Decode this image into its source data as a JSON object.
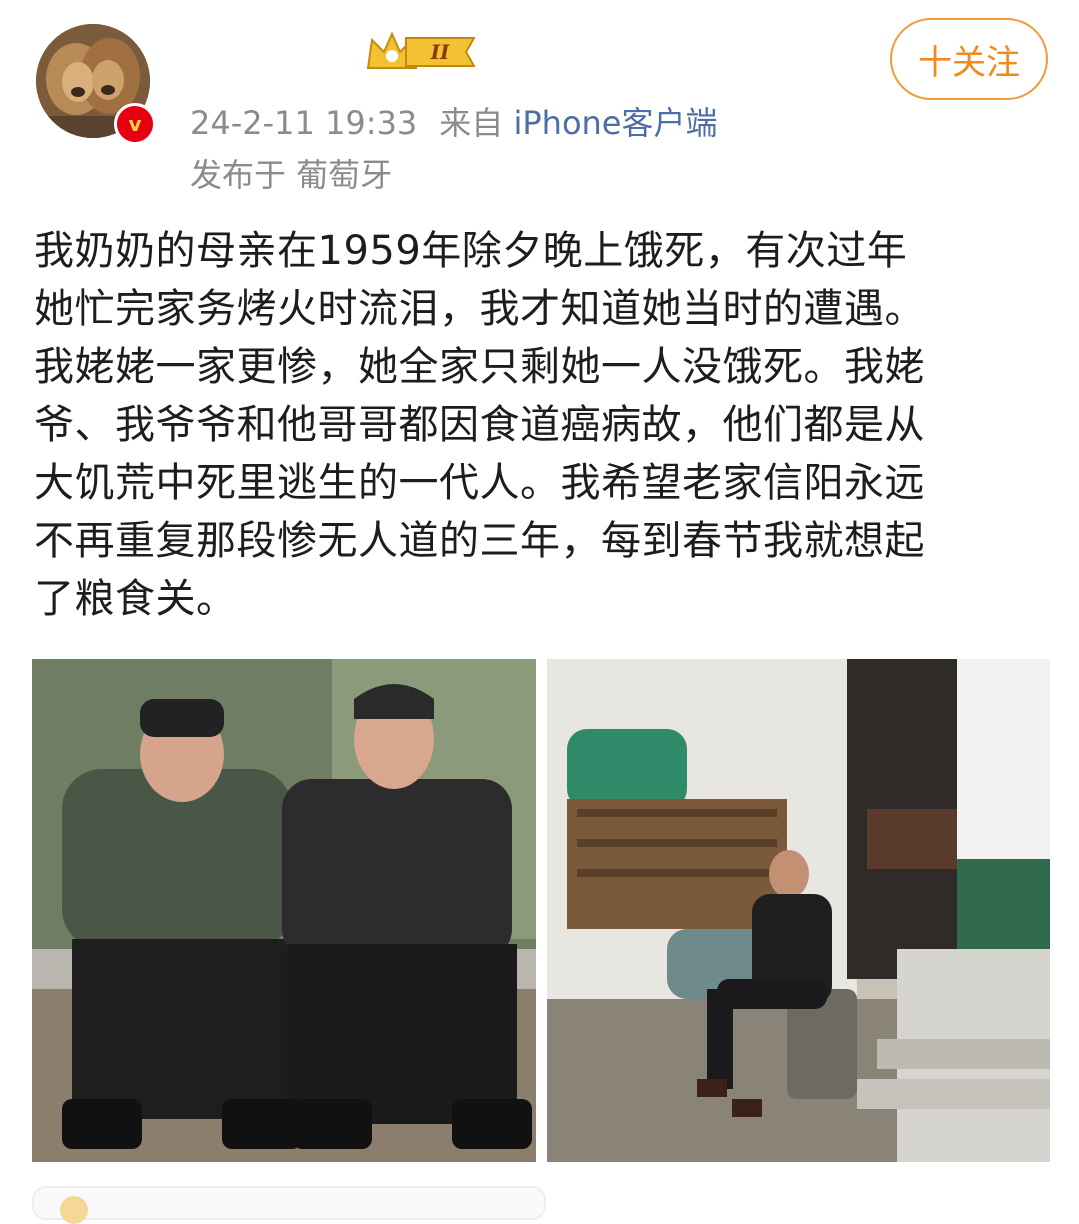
{
  "post": {
    "timestamp": "24-2-11 19:33",
    "from_label": "来自",
    "source": "iPhone客户端",
    "location_line": "发布于 葡萄牙",
    "level_badge": "II",
    "follow_label": "十关注",
    "text_lines": [
      "我奶奶的母亲在1959年除夕晚上饿死，有次过年",
      "她忙完家务烤火时流泪，我才知道她当时的遭遇。",
      "我姥姥一家更惨，她全家只剩她一人没饿死。我姥",
      "爷、我爷爷和他哥哥都因食道癌病故，他们都是从",
      "大饥荒中死里逃生的一代人。我希望老家信阳永远",
      "不再重复那段惨无人道的三年，每到春节我就想起",
      "了粮食关。"
    ]
  },
  "colors": {
    "accent_orange": "#f08a1c",
    "meta_gray": "#8b8b8b",
    "link_blue": "#4e6ea8",
    "verified_red": "#e60012"
  },
  "icons": {
    "avatar": "lion-avatar",
    "verified": "verified-v-icon",
    "crown": "crown-level-icon"
  }
}
